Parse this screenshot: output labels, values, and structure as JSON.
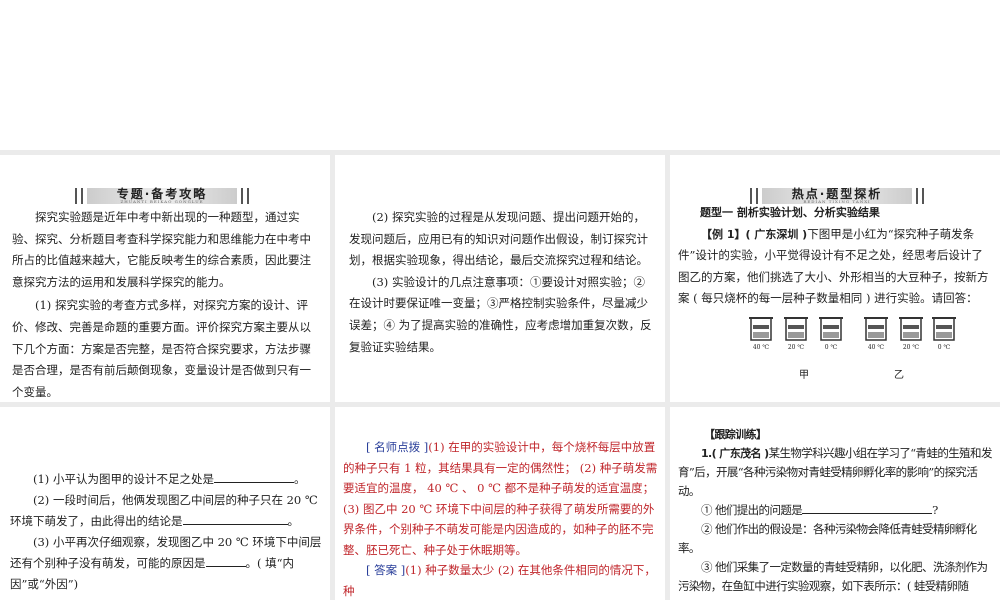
{
  "panel1": {
    "banner_title": "专题·备考攻略",
    "banner_sub": "ZHUANTI  BEIKAO GONGLUE",
    "paragraphs": [
      "探究实验题是近年中考中新出现的一种题型，通过实验、探究、分析题目考查科学探究能力和思维能力在中考中所占的比值越来越大，它能反映考生的综合素质，因此要注意探究方法的运用和发展科学探究的能力。",
      "(1) 探究实验的考查方式多样，对探究方案的设计、评价、修改、完善是命题的重要方面。评价探究方案主要从以下几个方面：方案是否完整，是否符合探究要求，方法步骤是否合理，是否有前后颠倒现象，变量设计是否做到只有一个变量。"
    ]
  },
  "panel2": {
    "paragraphs": [
      "(2) 探究实验的过程是从发现问题、提出问题开始的，发现问题后，应用已有的知识对问题作出假设，制订探究计划，根据实验现象，得出结论，最后交流探究过程和结论。",
      "(3) 实验设计的几点注意事项：①要设计对照实验；②在设计时要保证唯一变量；③严格控制实验条件，尽量减少误差；④ 为了提高实验的准确性，应考虑增加重复次数，反复验证实验结果。"
    ]
  },
  "panel3": {
    "banner_title": "热点·题型探析",
    "banner_sub": "REDIAN  TIXING TANXI",
    "heading": "题型一  剖析实验计划、分析实验结果",
    "example_label": "【例  1】",
    "example_source": "( 广东深圳 )",
    "example_text": "下图甲是小红为“探究种子萌发条件”设计的实验，小平觉得设计有不足之处，经思考后设计了图乙的方案，他们挑选了大小、外形相当的大豆种子，按新方案 ( 每只烧杯的每一层种子数量相同 ) 进行实验。请回答：",
    "figure": {
      "beakers": [
        "40 ℃",
        "20 ℃",
        "0 ℃",
        "40 ℃",
        "20 ℃",
        "0 ℃"
      ],
      "label_a": "甲",
      "label_b": "乙"
    }
  },
  "panel4": {
    "q1": "(1) 小平认为图甲的设计不足之处是",
    "q1_end": "。",
    "q2": "(2) 一段时间后，他俩发现图乙中间层的种子只在  20 ℃ 环境下萌发了，由此得出的结论是",
    "q2_end": "。",
    "q3": "(3) 小平再次仔细观察，发现图乙中  20 ℃ 环境下中间层还有个别种子没有萌发，可能的原因是",
    "q3_end": "。( 填“内因”或“外因”)"
  },
  "panel5": {
    "tip_label": "[ 名师点拨 ]",
    "tip_text": "(1) 在甲的实验设计中，每个烧杯每层中放置的种子只有  1 粒，其结果具有一定的偶然性； (2) 种子萌发需要适宜的温度， 40 ℃ 、 0 ℃ 都不是种子萌发的适宜温度； (3) 图乙中 20 ℃ 环境下中间层的种子获得了萌发所需要的外界条件，个别种子不萌发可能是内因造成的，如种子的胚不完整、胚已死亡、种子处于休眠期等。",
    "answer_label": "[ 答案 ]",
    "answer_text": "(1) 种子数量太少  (2) 在其他条件相同的情况下，种"
  },
  "panel6": {
    "heading": "【跟踪训练】",
    "q_num": "1.",
    "q_source": "( 广东茂名 )",
    "q_text": "某生物学科兴趣小组在学习了“青蛙的生殖和发育”后，开展“各种污染物对青蛙受精卵孵化率的影响”的探究活动。",
    "item1": "① 他们提出的问题是",
    "item1_end": "?",
    "item2": "② 他们作出的假设是：各种污染物会降低青蛙受精卵孵化率。",
    "item3": "③ 他们采集了一定数量的青蛙受精卵，以化肥、洗涤剂作为污染物，在鱼缸中进行实验观察，如下表所示：( 蛙受精卵随"
  }
}
